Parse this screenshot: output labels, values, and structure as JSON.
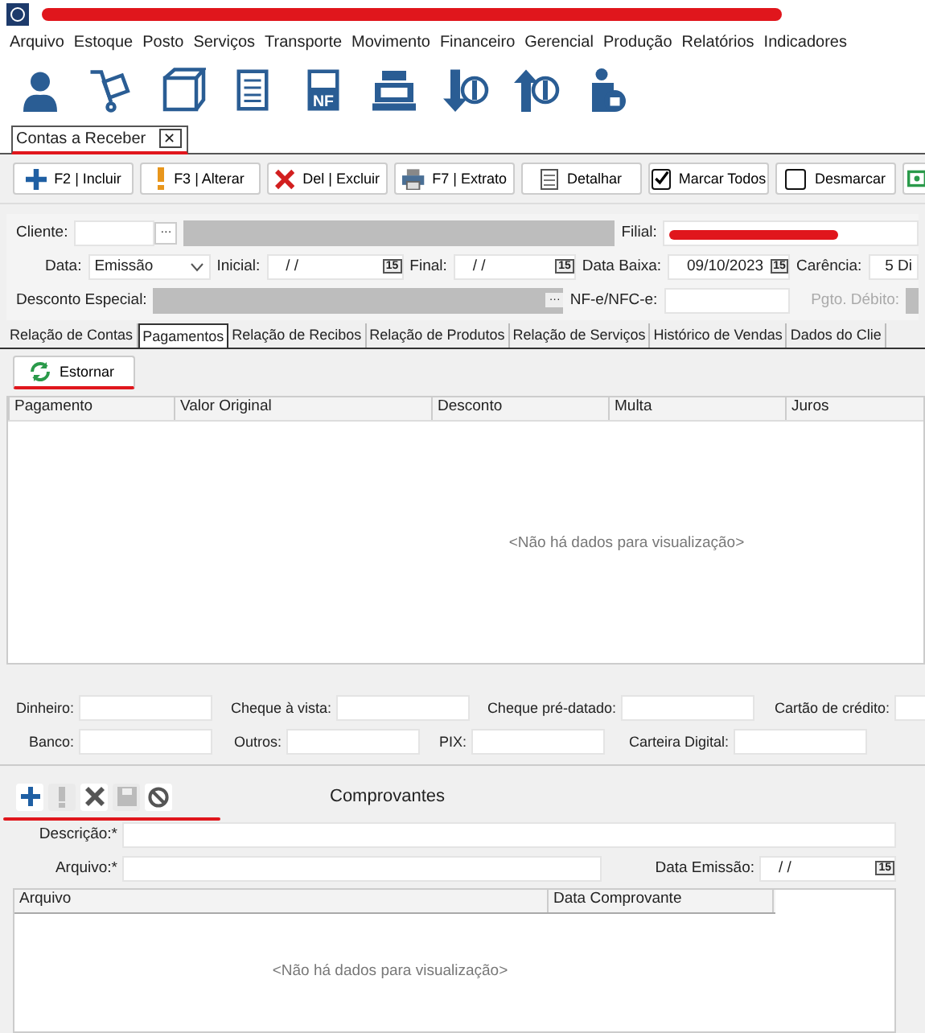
{
  "menu": [
    "Arquivo",
    "Estoque",
    "Posto",
    "Serviços",
    "Transporte",
    "Movimento",
    "Financeiro",
    "Gerencial",
    "Produção",
    "Relatórios",
    "Indicadores"
  ],
  "toolbar_icons": [
    {
      "kind": "person"
    },
    {
      "kind": "cart"
    },
    {
      "kind": "box"
    },
    {
      "kind": "document"
    },
    {
      "kind": "invoice",
      "label": "NF"
    },
    {
      "kind": "register"
    },
    {
      "kind": "money-down"
    },
    {
      "kind": "money-up"
    },
    {
      "kind": "lock-person"
    }
  ],
  "document_tab": {
    "label": "Contas a Receber",
    "close": "✕"
  },
  "actions": [
    {
      "kind": "add",
      "label": "F2 | Incluir"
    },
    {
      "kind": "edit",
      "label": "F3 | Alterar"
    },
    {
      "kind": "delete",
      "label": "Del | Excluir"
    },
    {
      "kind": "print",
      "label": "F7 | Extrato"
    },
    {
      "kind": "detail",
      "label": "Detalhar"
    },
    {
      "kind": "check",
      "label": "Marcar Todos",
      "checked": true
    },
    {
      "kind": "check",
      "label": "Desmarcar",
      "checked": false
    },
    {
      "kind": "money"
    }
  ],
  "filters": {
    "cliente": {
      "label": "Cliente:",
      "button": "···"
    },
    "filial": {
      "label": "Filial:"
    },
    "data": {
      "label": "Data:",
      "value": "Emissão"
    },
    "inicial": {
      "label": "Inicial:",
      "value": "/ /",
      "calendar": "15"
    },
    "final": {
      "label": "Final:",
      "value": "/ /",
      "calendar": "15"
    },
    "data_baixa": {
      "label": "Data Baixa:",
      "value": "09/10/2023",
      "calendar": "15"
    },
    "carencia": {
      "label": "Carência:",
      "value": "5 Di"
    },
    "desconto": {
      "label": "Desconto Especial:",
      "button": "···"
    },
    "nfe": {
      "label": "NF-e/NFC-e:"
    },
    "pgto_debito": {
      "label": "Pgto. Débito:",
      "disabled": true
    }
  },
  "tabs": [
    {
      "label": "Relação de Contas",
      "selected": false
    },
    {
      "label": "Pagamentos",
      "selected": true
    },
    {
      "label": "Relação de Recibos",
      "selected": false
    },
    {
      "label": "Relação de Produtos",
      "selected": false
    },
    {
      "label": "Relação de Serviços",
      "selected": false
    },
    {
      "label": "Histórico de Vendas",
      "selected": false
    },
    {
      "label": "Dados do Clie",
      "selected": false
    }
  ],
  "estornar": {
    "label": "Estornar"
  },
  "payments_table": {
    "columns": [
      "Pagamento",
      "Valor Original",
      "Desconto",
      "Multa",
      "Juros"
    ],
    "empty_message": "<Não há dados para visualização>"
  },
  "payment_fields": [
    [
      {
        "label": "Dinheiro:"
      },
      {
        "label": "Cheque à vista:"
      },
      {
        "label": "Cheque pré-datado:"
      },
      {
        "label": "Cartão de crédito:"
      }
    ],
    [
      {
        "label": "Banco:"
      },
      {
        "label": "Outros:"
      },
      {
        "label": "PIX:"
      },
      {
        "label": "Carteira Digital:"
      }
    ]
  ],
  "comprovantes": {
    "title": "Comprovantes",
    "tools": [
      {
        "kind": "add",
        "disabled": false
      },
      {
        "kind": "edit",
        "disabled": true
      },
      {
        "kind": "delete",
        "disabled": false
      },
      {
        "kind": "save",
        "disabled": true
      },
      {
        "kind": "cancel",
        "disabled": false
      }
    ],
    "descricao": {
      "label": "Descrição:*"
    },
    "arquivo": {
      "label": "Arquivo:*"
    },
    "data_emissao": {
      "label": "Data Emissão:",
      "value": "/ /",
      "calendar": "15"
    },
    "table": {
      "columns": [
        "Arquivo",
        "Data Comprovante"
      ],
      "empty_message": "<Não há dados para visualização>"
    }
  }
}
